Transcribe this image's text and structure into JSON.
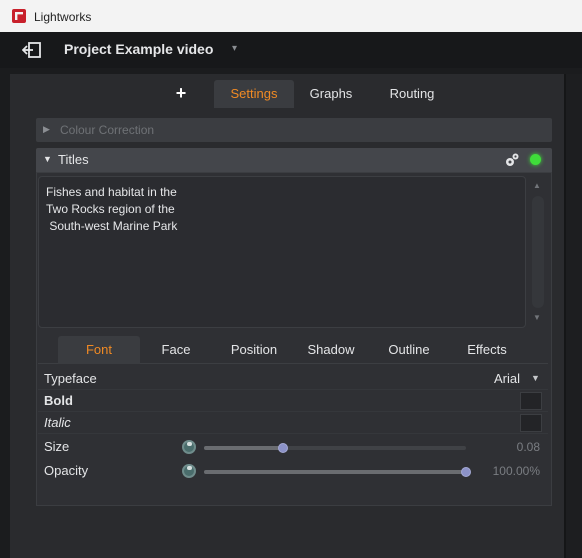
{
  "app": {
    "title": "Lightworks"
  },
  "project": {
    "title": "Project Example video",
    "caret": "▾"
  },
  "tabs": {
    "plus": "+",
    "settings": "Settings",
    "graphs": "Graphs",
    "routing": "Routing",
    "active": "Settings"
  },
  "sections": {
    "colour_correction": {
      "arrow": "▶",
      "label": "Colour Correction"
    },
    "titles": {
      "arrow": "▼",
      "label": "Titles",
      "status_color": "#3fdc3a"
    }
  },
  "titles_text": {
    "line1": "Fishes and habitat in the",
    "line2": "Two Rocks region of the",
    "line3": " South-west Marine Park"
  },
  "scrollbar": {
    "up": "▲",
    "down": "▼"
  },
  "subtabs": {
    "font": "Font",
    "face": "Face",
    "position": "Position",
    "shadow": "Shadow",
    "outline": "Outline",
    "effects": "Effects",
    "active": "Font"
  },
  "font_props": {
    "typeface": {
      "label": "Typeface",
      "value": "Arial",
      "caret": "▼"
    },
    "bold": {
      "label": "Bold"
    },
    "italic": {
      "label": "Italic"
    },
    "size": {
      "label": "Size",
      "value": "0.08",
      "level": 0.3
    },
    "opacity": {
      "label": "Opacity",
      "value": "100.00%",
      "level": 1.0
    }
  },
  "colors": {
    "accent": "#f08a24",
    "panel": "#2a2b2e",
    "header": "#44464b"
  },
  "icons": {
    "back": "exit-icon",
    "gears": "gears-icon",
    "reset": "reset-knob-icon"
  }
}
